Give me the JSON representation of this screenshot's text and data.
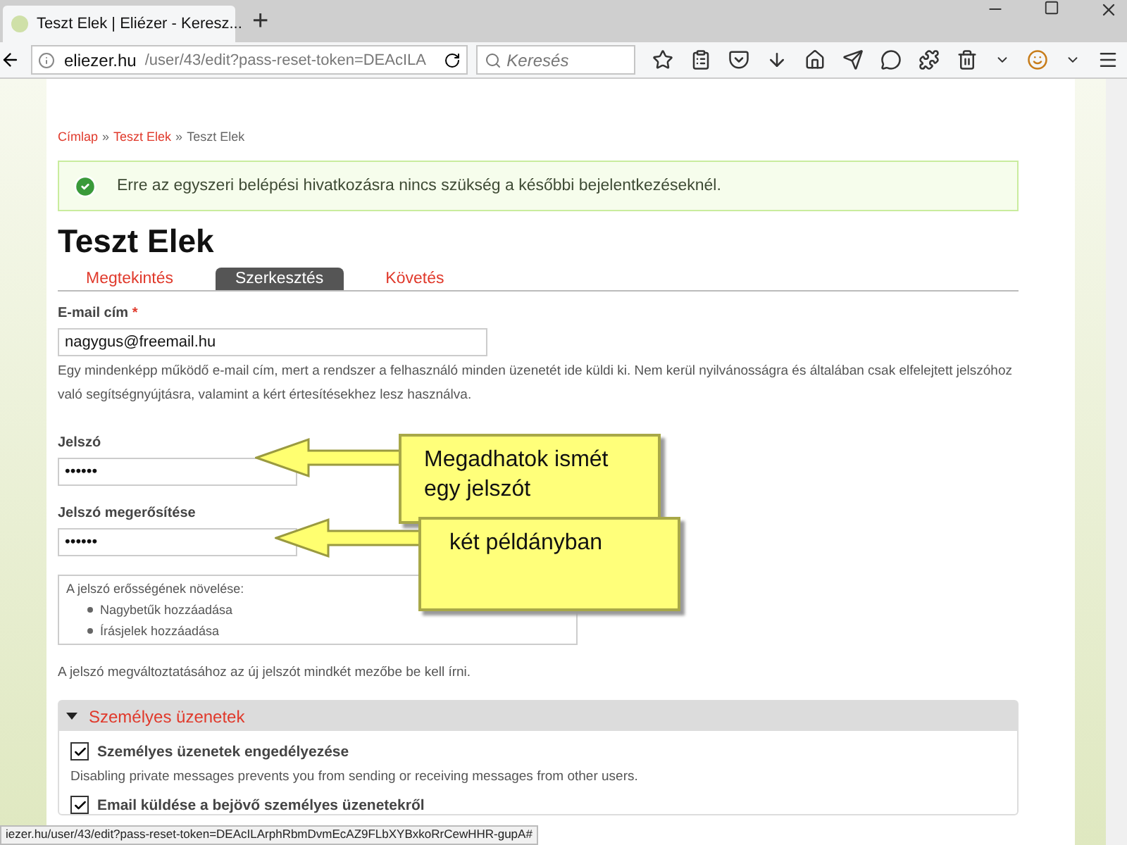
{
  "browser": {
    "tab_title": "Teszt Elek | Eliézer - Keresz...",
    "new_tab": "+",
    "url_host": "eliezer.hu",
    "url_path": "/user/43/edit?pass-reset-token=DEAcILA",
    "search_placeholder": "Keresés",
    "status_url": "iezer.hu/user/43/edit?pass-reset-token=DEAcILArphRbmDvmEcAZ9FLbXYBxkoRrCewHHR-gupA#"
  },
  "breadcrumb": [
    {
      "label": "Címlap",
      "link": true
    },
    {
      "label": "»",
      "link": false
    },
    {
      "label": "Teszt Elek",
      "link": true
    },
    {
      "label": "»",
      "link": false
    },
    {
      "label": "Teszt Elek",
      "link": false
    }
  ],
  "message": "Erre az egyszeri belépési hivatkozásra nincs szükség a későbbi bejelentkezéseknél.",
  "title": "Teszt Elek",
  "tabs": [
    {
      "label": "Megtekintés",
      "selected": false
    },
    {
      "label": "Szerkesztés",
      "selected": true
    },
    {
      "label": "Követés",
      "selected": false
    }
  ],
  "email": {
    "label": "E-mail cím",
    "required": "*",
    "value": "nagygus@freemail.hu",
    "description": "Egy mindenképp működő e-mail cím, mert a rendszer a felhasználó minden üzenetét ide küldi ki. Nem kerül nyilvánosságra és általában csak elfelejtett jelszóhoz való segítségnyújtásra, valamint a kért értesítésekhez lesz használva."
  },
  "password_fields": [
    {
      "label": "Jelszó",
      "value": "••••••"
    },
    {
      "label": "Jelszó megerősítése",
      "value": "••••••"
    }
  ],
  "strength": {
    "title": "A jelszó erősségének növelése:",
    "items": [
      "Nagybetűk hozzáadása",
      "Írásjelek hozzáadása"
    ]
  },
  "password_note": "A jelszó megváltoztatásához az új jelszót mindkét mezőbe be kell írni.",
  "section": {
    "title": "Személyes üzenetek",
    "expanded": true,
    "options": [
      {
        "label": "Személyes üzenetek engedélyezése",
        "checked": true,
        "description": "Disabling private messages prevents you from sending or receiving messages from other users."
      },
      {
        "label": "Email küldése a bejövő személyes üzenetekről",
        "checked": true
      }
    ]
  },
  "callouts": [
    {
      "lines": [
        "Megadhatok ismét",
        "egy jelszót"
      ]
    },
    {
      "lines": [
        "két példányban"
      ]
    }
  ]
}
